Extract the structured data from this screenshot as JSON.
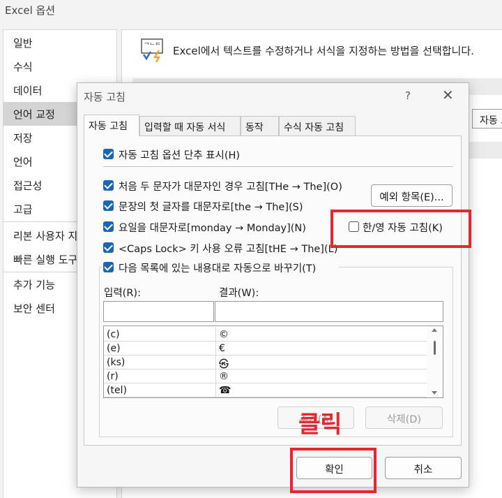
{
  "window": {
    "title": "Excel 옵션"
  },
  "sidebar": {
    "items": [
      {
        "label": "일반"
      },
      {
        "label": "수식"
      },
      {
        "label": "데이터"
      },
      {
        "label": "언어 교정"
      },
      {
        "label": "저장"
      },
      {
        "label": "언어"
      },
      {
        "label": "접근성"
      },
      {
        "label": "고급"
      },
      {
        "label": "리본 사용자 지정"
      },
      {
        "label": "빠른 실행 도구 모음"
      },
      {
        "label": "추가 기능"
      },
      {
        "label": "보안 센터"
      }
    ],
    "selected": "언어 교정"
  },
  "main": {
    "heading": "Excel에서 텍스트를 수정하거나 서식을 지정하는 방법을 선택합니다.",
    "autocorrect_button": "자동 고침 옵션(A)..."
  },
  "dialog": {
    "title": "자동 고침",
    "help": "?",
    "close": "✕",
    "tabs": [
      {
        "label": "자동 고침",
        "active": true
      },
      {
        "label": "입력할 때 자동 서식",
        "active": false
      },
      {
        "label": "동작",
        "active": false
      },
      {
        "label": "수식 자동 고침",
        "active": false
      }
    ],
    "options": {
      "show_buttons": {
        "label": "자동 고침 옵션 단추 표시(H)",
        "checked": true
      },
      "two_initial_caps": {
        "label": "처음 두 문자가 대문자인 경우 고침[THe → The](O)",
        "checked": true
      },
      "capitalize_sentence": {
        "label": "문장의 첫 글자를 대문자로[the → The](S)",
        "checked": true
      },
      "capitalize_days": {
        "label": "요일을 대문자로[monday → Monday](N)",
        "checked": true
      },
      "caps_lock": {
        "label": "<Caps Lock> 키 사용 오류 고침[tHE → The](L)",
        "checked": true
      },
      "han_eng": {
        "label": "한/영 자동 고침(K)",
        "checked": false
      },
      "replace_text": {
        "label": "다음 목록에 있는 내용대로 자동으로 바꾸기(T)",
        "checked": true
      }
    },
    "exceptions_button": "예외 항목(E)...",
    "input_label": "입력(R):",
    "result_label": "결과(W):",
    "input_value": "",
    "result_value": "",
    "table": {
      "rows": [
        {
          "input": "(c)",
          "result": "©"
        },
        {
          "input": "(e)",
          "result": "€"
        },
        {
          "input": "(ks)",
          "result": "㉿"
        },
        {
          "input": "(r)",
          "result": "®"
        },
        {
          "input": "(tel)",
          "result": "☎"
        }
      ]
    },
    "add_button": "추가(A)",
    "delete_button": "삭제(D)",
    "ok_button": "확인",
    "cancel_button": "취소"
  },
  "annotation": {
    "click_text": "클릭",
    "highlight_color": "#e8262d"
  }
}
